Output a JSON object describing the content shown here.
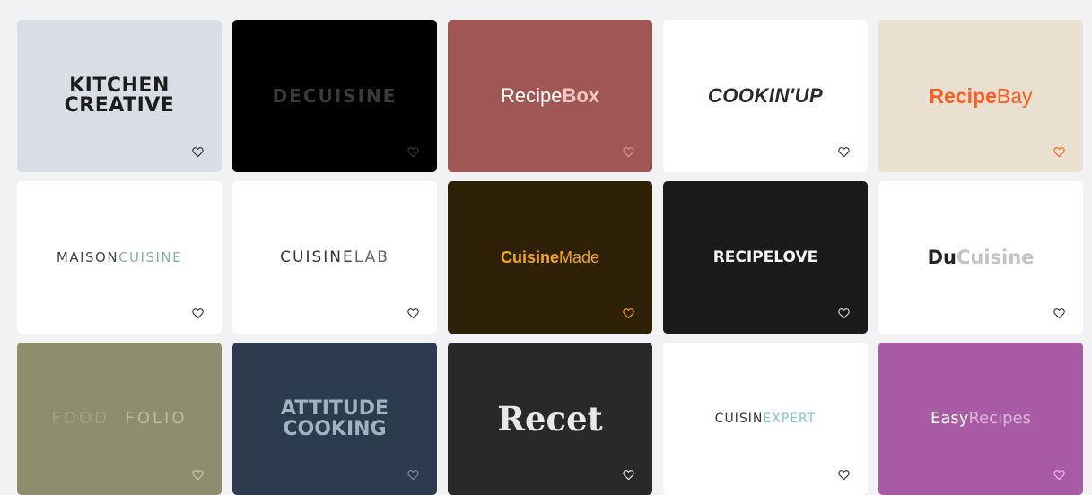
{
  "cards": [
    {
      "name": "card-kitchen-creative",
      "bg": "#d9dde4",
      "heart": "#2b2b2b",
      "logo": {
        "line1": "KITCHEN",
        "line2": "CREATIVE",
        "color": "#1d1d1d"
      }
    },
    {
      "name": "card-decuisine",
      "bg": "#000000",
      "heart": "#3a3a3a",
      "logo": {
        "text": "DECUISINE",
        "color": "#3a3a3a"
      }
    },
    {
      "name": "card-recipebox",
      "bg": "#a05754",
      "heart": "#d89a95",
      "logo": {
        "part1": "Recipe",
        "part2": "Box",
        "color": "#ffffff",
        "color2": "#f0c8c4"
      }
    },
    {
      "name": "card-cookinup",
      "bg": "#ffffff",
      "heart": "#333333",
      "logo": {
        "text": "COOKIN'UP",
        "color": "#2a2a2a"
      }
    },
    {
      "name": "card-recipebay",
      "bg": "#e9e0cf",
      "heart": "#ff5a1f",
      "logo": {
        "part1": "Recipe",
        "part2": "Bay",
        "color": "#ff5a1f"
      }
    },
    {
      "name": "card-maisoncuisine",
      "bg": "#ffffff",
      "heart": "#333333",
      "logo": {
        "part1": "MAISON",
        "part2": "CUISINE",
        "color": "#444444",
        "color2": "#7fb5a0"
      }
    },
    {
      "name": "card-cuisinelab",
      "bg": "#ffffff",
      "heart": "#333333",
      "logo": {
        "part1": "CUISINE",
        "part2": "LAB",
        "color": "#333333",
        "color2": "#666666"
      }
    },
    {
      "name": "card-cuisinemade",
      "bg": "#2e2108",
      "heart": "#f2a81d",
      "logo": {
        "part1": "Cuisine",
        "part2": "Made",
        "color": "#f2a81d"
      }
    },
    {
      "name": "card-recipelove",
      "bg": "#1a1a1a",
      "heart": "#dddddd",
      "logo": {
        "text": "RECIPELOVE",
        "color": "#f5f5f5"
      }
    },
    {
      "name": "card-ducuisine",
      "bg": "#ffffff",
      "heart": "#333333",
      "logo": {
        "part1": "Du",
        "part2": "Cuisine",
        "color": "#222222",
        "color2": "#c4c4c4"
      }
    },
    {
      "name": "card-foodfolio",
      "bg": "#8d8e6e",
      "heart": "#c8c9b0",
      "logo": {
        "part1": "FOOD",
        "part2": "FOLIO",
        "color": "#a1a282",
        "color2": "#b9baa0"
      }
    },
    {
      "name": "card-attitude-cooking",
      "bg": "#2c3b4e",
      "heart": "#8090a0",
      "logo": {
        "line1": "ATTITUDE",
        "line2": "COOKING",
        "color": "#9fb3c2"
      }
    },
    {
      "name": "card-recet",
      "bg": "#29292b",
      "heart": "#e6e6e6",
      "logo": {
        "text": "Recet",
        "color": "#e8e8e8"
      }
    },
    {
      "name": "card-cuisinexpert",
      "bg": "#ffffff",
      "heart": "#333333",
      "logo": {
        "part1": "CUISIN",
        "part2": "EXPERT",
        "color": "#333333",
        "color2": "#7cc8c4"
      }
    },
    {
      "name": "card-easyrecipes",
      "bg": "#a95aa4",
      "heart": "#e8c8e6",
      "logo": {
        "part1": "Easy",
        "part2": "Recipes",
        "color": "#ffffff",
        "color2": "#dbb6d8"
      }
    }
  ]
}
